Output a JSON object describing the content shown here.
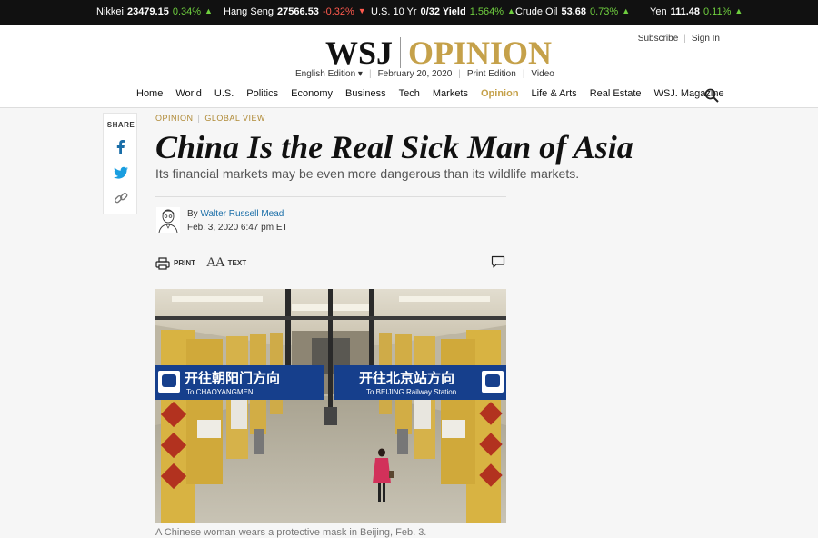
{
  "ticker": [
    {
      "name": "Nikkei",
      "value": "23479.15",
      "change": "0.34%",
      "dir": "up"
    },
    {
      "name": "Hang Seng",
      "value": "27566.53",
      "change": "-0.32%",
      "dir": "down"
    },
    {
      "name": "U.S. 10 Yr",
      "value": "0/32 Yield",
      "change": "1.564%",
      "dir": "up"
    },
    {
      "name": "Crude Oil",
      "value": "53.68",
      "change": "0.73%",
      "dir": "up"
    },
    {
      "name": "Yen",
      "value": "111.48",
      "change": "0.11%",
      "dir": "up"
    }
  ],
  "header": {
    "logo_wsj": "WSJ",
    "logo_section": "OPINION",
    "subscribe": "Subscribe",
    "sign_in": "Sign In",
    "edition": "English Edition ▾",
    "date": "February 20, 2020",
    "print_edition": "Print Edition",
    "video": "Video"
  },
  "nav": [
    "Home",
    "World",
    "U.S.",
    "Politics",
    "Economy",
    "Business",
    "Tech",
    "Markets",
    "Opinion",
    "Life & Arts",
    "Real Estate",
    "WSJ. Magazine"
  ],
  "nav_active": "Opinion",
  "share": {
    "label": "SHARE"
  },
  "article": {
    "kicker_section": "OPINION",
    "kicker_column": "GLOBAL VIEW",
    "headline": "China Is the Real Sick Man of Asia",
    "dek": "Its financial markets may be even more dangerous than its wildlife markets.",
    "by": "By",
    "author": "Walter Russell Mead",
    "date": "Feb. 3, 2020 6:47 pm ET",
    "print_label": "PRINT",
    "text_label": "TEXT",
    "caption": "A Chinese woman wears a protective mask in Beijing, Feb. 3."
  },
  "photo": {
    "sign_left_cn": "开往朝阳门方向",
    "sign_left_en": "To CHAOYANGMEN",
    "sign_right_cn": "开往北京站方向",
    "sign_right_en": "To BEIJING Railway Station"
  },
  "colors": {
    "accent": "#c5a14a",
    "link": "#1a6ea8",
    "ticker_up": "#6fcf3f",
    "ticker_down": "#ff5a4e"
  }
}
